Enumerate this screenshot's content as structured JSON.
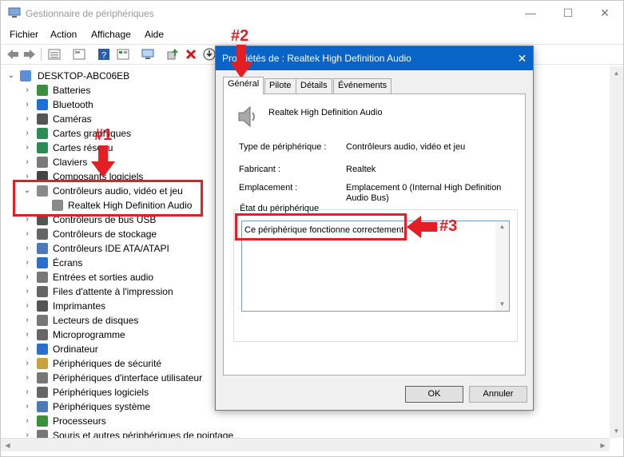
{
  "window": {
    "title": "Gestionnaire de périphériques",
    "minimize": "—",
    "maximize": "☐",
    "close": "✕"
  },
  "menu": [
    "Fichier",
    "Action",
    "Affichage",
    "Aide"
  ],
  "tree": {
    "root": "DESKTOP-ABC06EB",
    "items": [
      {
        "label": "Batteries",
        "color": "#3c8f3c"
      },
      {
        "label": "Bluetooth",
        "color": "#1e6fd9"
      },
      {
        "label": "Caméras",
        "color": "#555555"
      },
      {
        "label": "Cartes graphiques",
        "color": "#2e8b57"
      },
      {
        "label": "Cartes réseau",
        "color": "#2e8b57"
      },
      {
        "label": "Claviers",
        "color": "#7a7a7a"
      },
      {
        "label": "Composants logiciels",
        "color": "#444444"
      },
      {
        "label": "Contrôleurs audio, vidéo et jeu",
        "color": "#8a8a8a",
        "expanded": true
      },
      {
        "label": "Realtek High Definition Audio",
        "color": "#8a8a8a",
        "child": true
      },
      {
        "label": "Contrôleurs de bus USB",
        "color": "#555555"
      },
      {
        "label": "Contrôleurs de stockage",
        "color": "#666666"
      },
      {
        "label": "Contrôleurs IDE ATA/ATAPI",
        "color": "#4a7ab8"
      },
      {
        "label": "Écrans",
        "color": "#2a6fc9"
      },
      {
        "label": "Entrées et sorties audio",
        "color": "#777777"
      },
      {
        "label": "Files d'attente à l'impression",
        "color": "#666666"
      },
      {
        "label": "Imprimantes",
        "color": "#555555"
      },
      {
        "label": "Lecteurs de disques",
        "color": "#777777"
      },
      {
        "label": "Microprogramme",
        "color": "#666666"
      },
      {
        "label": "Ordinateur",
        "color": "#2a6fc9"
      },
      {
        "label": "Périphériques de sécurité",
        "color": "#c8a23a"
      },
      {
        "label": "Périphériques d'interface utilisateur",
        "color": "#777777"
      },
      {
        "label": "Périphériques logiciels",
        "color": "#666666"
      },
      {
        "label": "Périphériques système",
        "color": "#4a7ab8"
      },
      {
        "label": "Processeurs",
        "color": "#3c8f3c"
      },
      {
        "label": "Souris et autres périphériques de pointage",
        "color": "#777777"
      }
    ]
  },
  "dialog": {
    "title": "Propriétés de : Realtek High Definition Audio",
    "close": "✕",
    "tabs": [
      "Général",
      "Pilote",
      "Détails",
      "Événements"
    ],
    "device_name": "Realtek High Definition Audio",
    "props": [
      {
        "label": "Type de périphérique :",
        "value": "Contrôleurs audio, vidéo et jeu"
      },
      {
        "label": "Fabricant :",
        "value": "Realtek"
      },
      {
        "label": "Emplacement :",
        "value": "Emplacement 0 (Internal High Definition Audio Bus)"
      }
    ],
    "status_label": "État du périphérique",
    "status_text": "Ce périphérique fonctionne correctement.",
    "ok": "OK",
    "cancel": "Annuler"
  },
  "annotations": [
    "#1",
    "#2",
    "#3"
  ],
  "colors": {
    "annotation": "#e31e24",
    "dialog_title": "#0a64c8"
  }
}
